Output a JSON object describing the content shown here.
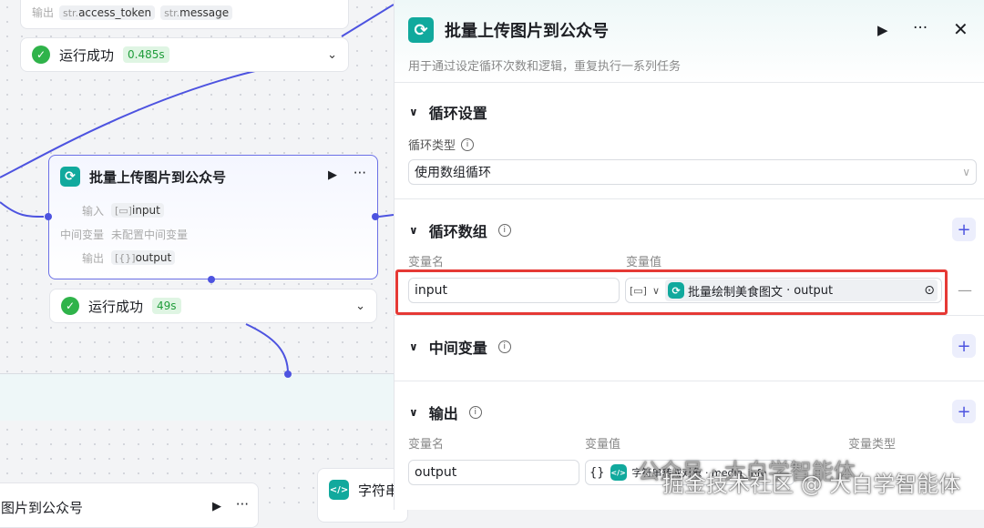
{
  "canvas": {
    "top_node": {
      "output_label": "输出",
      "outputs": [
        {
          "type": "str.",
          "name": "access_token"
        },
        {
          "type": "str.",
          "name": "message"
        }
      ],
      "status": "运行成功",
      "time": "0.485s"
    },
    "loop_node": {
      "title": "批量上传图片到公众号",
      "input_label": "输入",
      "input": "input",
      "mid_label": "中间变量",
      "mid_value": "未配置中间变量",
      "output_label": "输出",
      "output": "output",
      "status": "运行成功",
      "time": "49s"
    },
    "bottom_node": {
      "title": "图片到公众号"
    },
    "code_node": {
      "title": "字符串"
    }
  },
  "panel": {
    "title": "批量上传图片到公众号",
    "description": "用于通过设定循环次数和逻辑，重复执行一系列任务",
    "loop_settings": {
      "title": "循环设置",
      "type_label": "循环类型",
      "type_value": "使用数组循环"
    },
    "loop_array": {
      "title": "循环数组",
      "name_header": "变量名",
      "value_header": "变量值",
      "row": {
        "name": "input",
        "ref_node": "批量绘制美食图文",
        "ref_var": "output"
      }
    },
    "intermediate": {
      "title": "中间变量"
    },
    "output": {
      "title": "输出",
      "name_header": "变量名",
      "value_header": "变量值",
      "type_header": "变量类型",
      "row": {
        "name": "output",
        "ref": "字符串转成对象 · media_info"
      }
    }
  },
  "watermarks": [
    "公众号 · 大白学智能体",
    "掘金技术社区 @ 大白学智能体"
  ],
  "colors": {
    "accent": "#4d53e0",
    "teal": "#11a99d",
    "success": "#2fb34a",
    "highlight": "#e53935"
  }
}
